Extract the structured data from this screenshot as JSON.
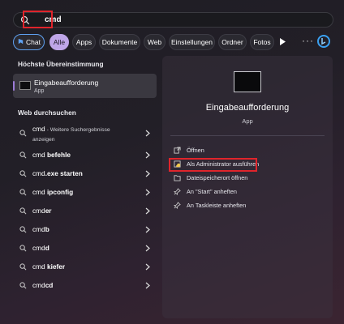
{
  "search": {
    "query": "cmd"
  },
  "chips": {
    "chat": "Chat",
    "alle": "Alle",
    "apps": "Apps",
    "dokumente": "Dokumente",
    "web": "Web",
    "einstellungen": "Einstellungen",
    "ordner": "Ordner",
    "fotos": "Fotos"
  },
  "best_match": {
    "title": "Höchste Übereinstimmung",
    "name": "Eingabeaufforderung",
    "type": "App"
  },
  "web": {
    "title": "Web durchsuchen",
    "items": [
      {
        "pre": "cmd",
        "bold": "",
        "muted": " - Weitere Suchergebnisse",
        "muted2": "anzeigen"
      },
      {
        "pre": "cmd ",
        "bold": "befehle"
      },
      {
        "pre": "cmd",
        "bold": ".exe starten"
      },
      {
        "pre": "cmd ",
        "bold": "ipconfig"
      },
      {
        "pre": "cmd",
        "bold": "er"
      },
      {
        "pre": "cmd",
        "bold": "b"
      },
      {
        "pre": "cmd",
        "bold": "d"
      },
      {
        "pre": "cmd ",
        "bold": "kiefer"
      },
      {
        "pre": "cmd",
        "bold": "cd"
      }
    ]
  },
  "details": {
    "name": "Eingabeaufforderung",
    "type": "App",
    "actions": [
      {
        "label": "Öffnen",
        "icon": "open-icon"
      },
      {
        "label": "Als Administrator ausführen",
        "icon": "shield-admin-icon"
      },
      {
        "label": "Dateispeicherort öffnen",
        "icon": "folder-icon"
      },
      {
        "label": "An \"Start\" anheften",
        "icon": "pin-icon"
      },
      {
        "label": "An Taskleiste anheften",
        "icon": "pin-icon"
      }
    ]
  },
  "colors": {
    "accent": "#bfa6e8",
    "highlight_box": "#e0242b"
  }
}
